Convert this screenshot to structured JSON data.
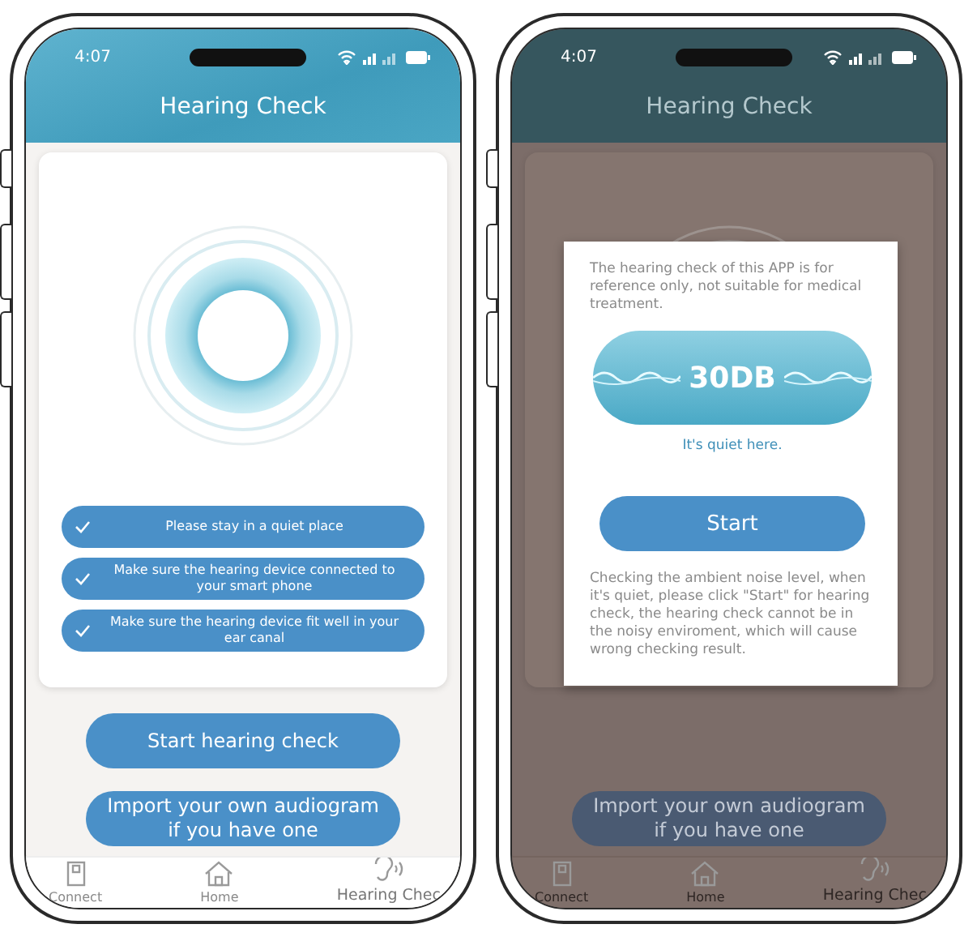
{
  "phones": [
    {
      "kind": "checklist",
      "status_time": "4:07",
      "title": "Hearing Check",
      "checklist": [
        {
          "label": "Please stay in a quiet place",
          "checked": true
        },
        {
          "label": "Make sure the hearing device connected to your smart phone",
          "checked": true
        },
        {
          "label": "Make sure the hearing device fit well in your ear canal",
          "checked": true
        }
      ],
      "buttons": [
        "Start hearing check",
        "Import your own audiogram if you have one"
      ],
      "tabs": [
        {
          "kind": "connect",
          "label": "Connect",
          "selected": false
        },
        {
          "kind": "home",
          "label": "Home",
          "selected": false
        },
        {
          "kind": "hearing",
          "label": "Hearing Chec",
          "selected": true
        }
      ]
    },
    {
      "kind": "dialog",
      "status_time": "4:07",
      "title": "Hearing Check",
      "buttons": [
        "Import your own audiogram if you have one"
      ],
      "tabs": [
        {
          "kind": "connect",
          "label": "Connect",
          "selected": false
        },
        {
          "kind": "home",
          "label": "Home",
          "selected": false
        },
        {
          "kind": "hearing",
          "label": "Hearing Chec",
          "selected": true
        }
      ],
      "dialog": {
        "notice": "The hearing check of this APP is for reference only, not suitable for medical treatment.",
        "noise_level": "30DB",
        "noise_status": "It's quiet here.",
        "start_button": "Start",
        "info": "Checking the ambient noise level, when it's quiet, please click \"Start\" for hearing check, the hearing check cannot be in the noisy enviroment, which will cause wrong checking result."
      }
    }
  ]
}
